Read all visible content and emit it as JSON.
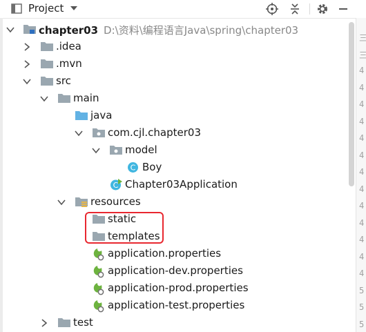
{
  "toolbar": {
    "title": "Project",
    "icons": [
      "project-window-icon",
      "chevron-down-icon",
      "locate-target-icon",
      "collapse-all-icon",
      "gear-icon",
      "minimize-icon"
    ]
  },
  "tree": {
    "root": {
      "name": "chapter03",
      "path": "D:\\资料\\编程语言Java\\spring\\chapter03"
    },
    "idea": ".idea",
    "mvn": ".mvn",
    "src": "src",
    "main": "main",
    "java": "java",
    "package": "com.cjl.chapter03",
    "model": "model",
    "boy": "Boy",
    "app": "Chapter03Application",
    "resources": "resources",
    "static": "static",
    "templates": "templates",
    "props": [
      "application.properties",
      "application-dev.properties",
      "application-prod.properties",
      "application-test.properties"
    ],
    "test": "test"
  },
  "gutter_marks": [
    "三",
    "三",
    "4",
    "4",
    "4",
    "4",
    "4",
    "4",
    "4",
    "4",
    "4",
    "4",
    "4",
    "4",
    "4",
    "5",
    "5",
    "5"
  ],
  "colors": {
    "highlight": "#e8272f",
    "folder": "#9aa7b0",
    "java_folder": "#62b2e4",
    "class": "#40b6e0",
    "spring": "#6db33f"
  }
}
